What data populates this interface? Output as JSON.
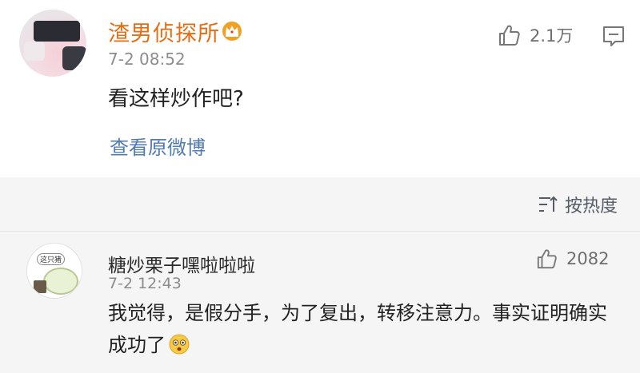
{
  "post": {
    "username": "渣男侦探所",
    "time": "7-2 08:52",
    "like_count": "2.1万",
    "text": "看这样炒作吧?",
    "view_original": "查看原微博"
  },
  "sort": {
    "label": "按热度"
  },
  "reply": {
    "username": "糖炒栗子嘿啦啦啦",
    "time": "7-2 12:43",
    "like_count": "2082",
    "text": "我觉得，是假分手，为了复出，转移注意力。事实证明确实成功了",
    "avatar_tag": "这只猪"
  },
  "colors": {
    "username_highlight": "#e86b10",
    "link": "#4f7ab2",
    "crown": "#f2a023"
  },
  "icons": [
    "crown-icon",
    "thumbs-up-icon",
    "reply-icon",
    "sort-icon",
    "surprised-emoji-icon"
  ]
}
